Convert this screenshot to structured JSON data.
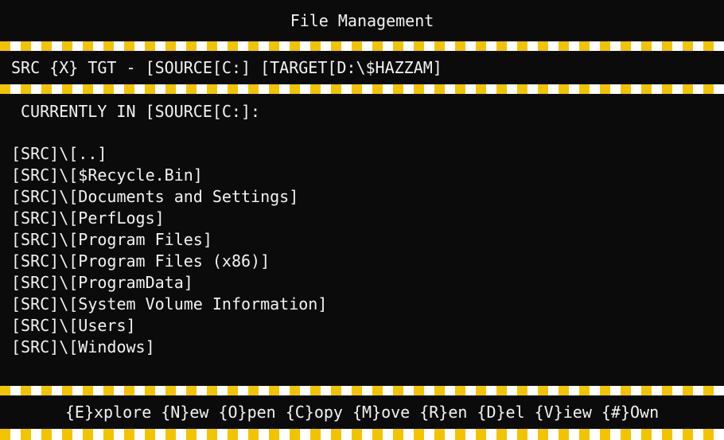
{
  "header": {
    "title": "File Management"
  },
  "pathbar": {
    "text": "SRC {X} TGT - [SOURCE[C:] [TARGET[D:\\$HAZZAM]"
  },
  "main": {
    "current_label": "CURRENTLY IN [SOURCE[C:]:",
    "entries": [
      "[SRC]\\[..]",
      "[SRC]\\[$Recycle.Bin]",
      "[SRC]\\[Documents and Settings]",
      "[SRC]\\[PerfLogs]",
      "[SRC]\\[Program Files]",
      "[SRC]\\[Program Files (x86)]",
      "[SRC]\\[ProgramData]",
      "[SRC]\\[System Volume Information]",
      "[SRC]\\[Users]",
      "[SRC]\\[Windows]"
    ]
  },
  "footer": {
    "commands": [
      "{E}xplore",
      "{N}ew",
      "{O}pen",
      "{C}opy",
      "{M}ove",
      "{R}en",
      "{D}el",
      "{V}iew",
      "{#}Own"
    ]
  },
  "colors": {
    "background": "#0b0b0b",
    "text": "#f2f2f2",
    "stripe_yellow": "#f2c400",
    "stripe_white": "#ffffff"
  }
}
